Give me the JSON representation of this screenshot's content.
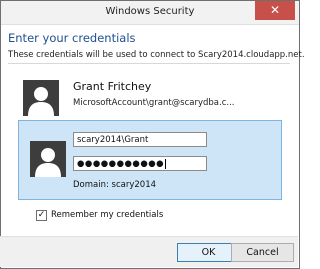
{
  "window": {
    "title": "Windows Security",
    "close_glyph": "✕"
  },
  "dialog": {
    "heading": "Enter your credentials",
    "subheading": "These credentials will be used to connect to Scary2014.cloudapp.net."
  },
  "account1": {
    "name": "Grant Fritchey",
    "id": "MicrosoftAccount\\grant@scarydba.c..."
  },
  "account2": {
    "username_value": "scary2014\\Grant",
    "password_value": "●●●●●●●●●●●",
    "domain": "Domain: scary2014"
  },
  "remember": {
    "label": "Remember my credentials",
    "checked": true,
    "check_glyph": "✓"
  },
  "buttons": {
    "ok": "OK",
    "cancel": "Cancel"
  },
  "colors": {
    "accent": "#1f4f8f",
    "close": "#c7504a",
    "selection": "#cde5f7"
  }
}
